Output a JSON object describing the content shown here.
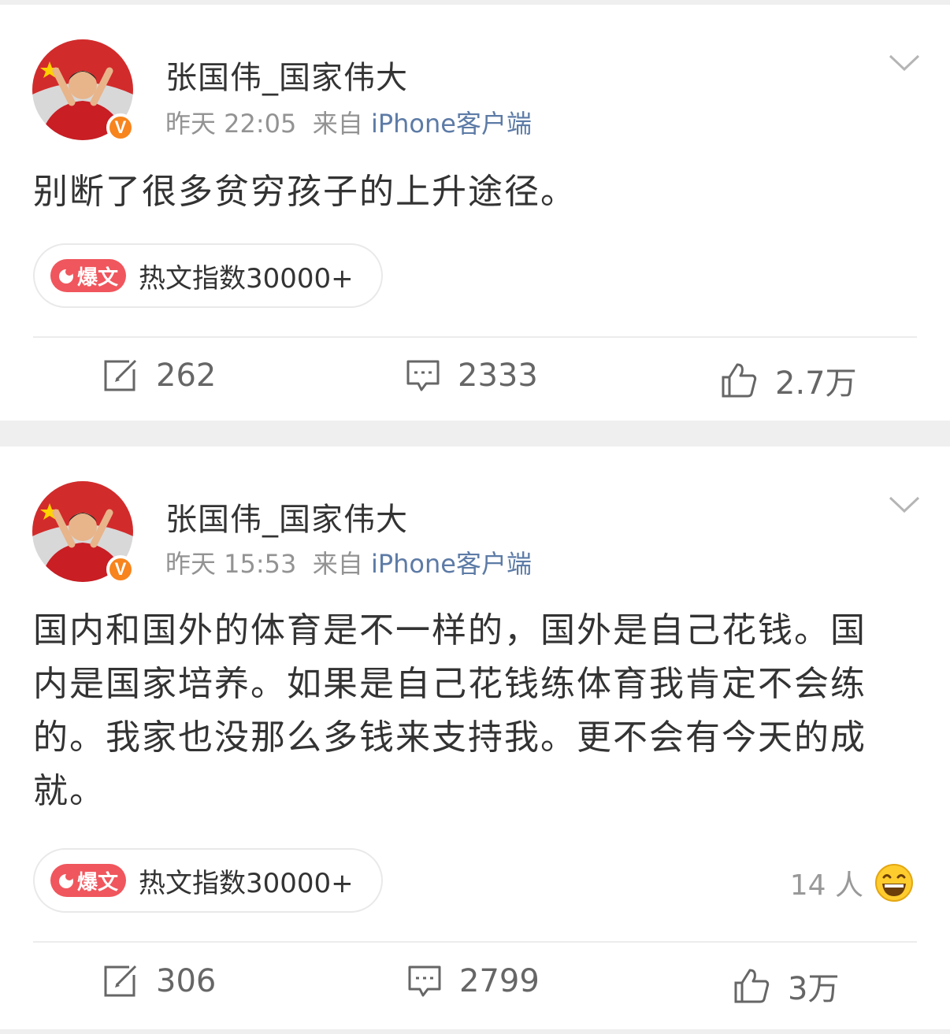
{
  "posts": [
    {
      "username": "张国伟_国家伟大",
      "time": "昨天 22:05",
      "source_prefix": "来自",
      "source": "iPhone客户端",
      "text": "别断了很多贫穷孩子的上升途径。",
      "hot_badge": "爆文",
      "hot_index": "热文指数30000+",
      "reposts": "262",
      "comments": "2333",
      "likes": "2.7万"
    },
    {
      "username": "张国伟_国家伟大",
      "time": "昨天 15:53",
      "source_prefix": "来自",
      "source": "iPhone客户端",
      "text": "国内和国外的体育是不一样的，国外是自己花钱。国内是国家培养。如果是自己花钱练体育我肯定不会练的。我家也没那么多钱来支持我。更不会有今天的成就。",
      "hot_badge": "爆文",
      "hot_index": "热文指数30000+",
      "reaction_count": "14 人",
      "reposts": "306",
      "comments": "2799",
      "likes": "3万"
    }
  ],
  "verified_badge": "V",
  "colors": {
    "source_link": "#5d7ba6",
    "hot_badge": "#f0565d",
    "verified": "#f7841d",
    "background": "#efefef"
  },
  "icons": [
    "repost-icon",
    "comment-icon",
    "like-icon",
    "chevron-down-icon",
    "fire-icon",
    "laugh-emoji-icon"
  ]
}
